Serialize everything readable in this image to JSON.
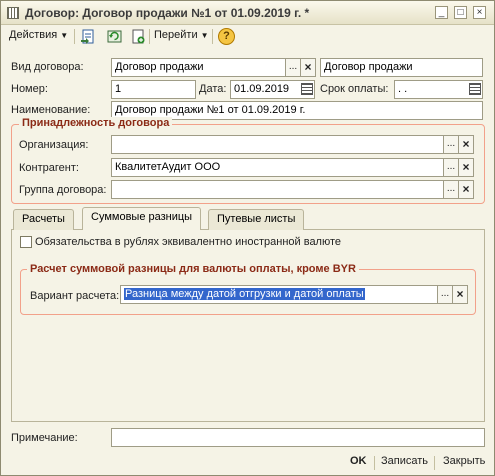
{
  "window": {
    "title": "Договор: Договор  продажи №1 от 01.09.2019 г. *",
    "controls": [
      "_",
      "□",
      "×"
    ]
  },
  "toolbar": {
    "actions_label": "Действия",
    "goto_label": "Перейти",
    "help_label": "?"
  },
  "form": {
    "contract_kind_label": "Вид договора:",
    "contract_kind_value": "Договор  продажи",
    "contract_kind_type": "Договор  продажи",
    "number_label": "Номер:",
    "number_value": "1",
    "date_label": "Дата:",
    "date_value": "01.09.2019",
    "payment_term_label": "Срок оплаты:",
    "payment_term_value": " .  .",
    "name_label": "Наименование:",
    "name_value": "Договор  продажи №1 от 01.09.2019 г."
  },
  "ownership": {
    "title": "Принадлежность договора",
    "organization_label": "Организация:",
    "organization_value": "",
    "counterparty_label": "Контрагент:",
    "counterparty_value": "КвалитетАудит ООО",
    "group_label": "Группа договора:",
    "group_value": ""
  },
  "tabs": [
    {
      "label": "Расчеты"
    },
    {
      "label": "Суммовые разницы"
    },
    {
      "label": "Путевые листы"
    }
  ],
  "sum_diff": {
    "checkbox_label": "Обязательства в рублях эквивалентно иностранной валюте",
    "checkbox_checked": false,
    "group_title": "Расчет суммовой разницы для валюты оплаты, кроме BYR",
    "variant_label": "Вариант расчета:",
    "variant_value": "Разница между датой отгрузки и датой оплаты"
  },
  "note": {
    "label": "Примечание:",
    "value": ""
  },
  "footer": {
    "ok_label": "OK",
    "save_label": "Записать",
    "close_label": "Закрыть"
  },
  "colors": {
    "accent": "#8b2a16",
    "group_border": "#f2a18a",
    "selection": "#3366cc"
  },
  "icons": [
    "window-icon",
    "document-icon",
    "refresh-icon",
    "new-document-icon",
    "help-icon",
    "calendar-icon",
    "select-icon",
    "clear-icon",
    "checkbox-icon"
  ]
}
